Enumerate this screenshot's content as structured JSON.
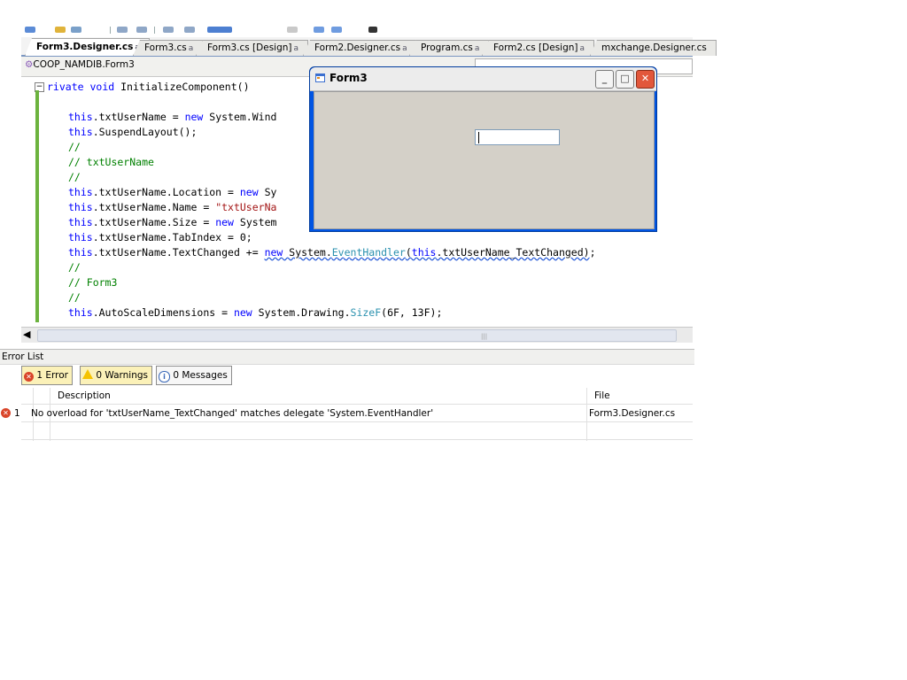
{
  "tabs": [
    {
      "label": "Form3.Designer.cs",
      "active": true,
      "lock": "a"
    },
    {
      "label": "Form3.cs",
      "active": false,
      "lock": "a"
    },
    {
      "label": "Form3.cs [Design]",
      "active": false,
      "lock": "a"
    },
    {
      "label": "Form2.Designer.cs",
      "active": false,
      "lock": "a"
    },
    {
      "label": "Program.cs",
      "active": false,
      "lock": "a"
    },
    {
      "label": "Form2.cs [Design]",
      "active": false,
      "lock": "a"
    },
    {
      "label": "mxchange.Designer.cs",
      "active": false,
      "lock": ""
    }
  ],
  "navbar": {
    "class_combo": "COOP_NAMDIB.Form3"
  },
  "code": {
    "l0_a": "rivate ",
    "l0_b": "void",
    "l0_c": " InitializeComponent()",
    "l1_this": "this",
    "l1_rest": ".txtUserName = ",
    "l1_new": "new",
    "l1_tail": " System.Wind",
    "l2_this": "this",
    "l2_rest": ".SuspendLayout();",
    "l3": "//",
    "l4": "// txtUserName",
    "l5": "//",
    "l6_this": "this",
    "l6_rest": ".txtUserName.Location = ",
    "l6_new": "new",
    "l6_tail": " Sy",
    "l7_this": "this",
    "l7_rest": ".txtUserName.Name = ",
    "l7_str": "\"txtUserNa",
    "l8_this": "this",
    "l8_rest": ".txtUserName.Size = ",
    "l8_new": "new",
    "l8_tail": " System",
    "l9_this": "this",
    "l9_rest": ".txtUserName.TabIndex = 0;",
    "l10_this": "this",
    "l10_rest": ".txtUserName.TextChanged += ",
    "l10_new": "new",
    "l10_sys": " System.",
    "l10_type": "EventHandler",
    "l10_open": "(",
    "l10_this2": "this",
    "l10_arg": ".txtUserName_TextChanged)",
    "l10_end": ";",
    "l11": "//",
    "l12": "// Form3",
    "l13": "//",
    "l14_this": "this",
    "l14_rest": ".AutoScaleDimensions = ",
    "l14_new": "new",
    "l14_sys": " System.Drawing.",
    "l14_type": "SizeF",
    "l14_args": "(6F, 13F);"
  },
  "form3": {
    "title": "Form3",
    "minimize_glyph": "_",
    "maximize_glyph": "□",
    "close_glyph": "✕"
  },
  "error_list": {
    "title": "Error List",
    "filters": {
      "errors": "1 Error",
      "warnings": "0 Warnings",
      "messages": "0 Messages"
    },
    "columns": {
      "description": "Description",
      "file": "File"
    },
    "rows": [
      {
        "number": "1",
        "description": "No overload for 'txtUserName_TextChanged' matches delegate 'System.EventHandler'",
        "file": "Form3.Designer.cs"
      }
    ]
  },
  "colors": {
    "keyword": "#0000ff",
    "comment": "#008000",
    "string": "#a31515",
    "type": "#2b91af",
    "error_badge": "#d9452a",
    "window_frame": "#0054e3"
  },
  "icons": {
    "class_icon": "class-icon",
    "form_icon": "form-icon",
    "error_icon": "error-icon",
    "warning_icon": "warning-icon",
    "info_icon": "info-icon",
    "lock_icon": "lock-icon"
  }
}
